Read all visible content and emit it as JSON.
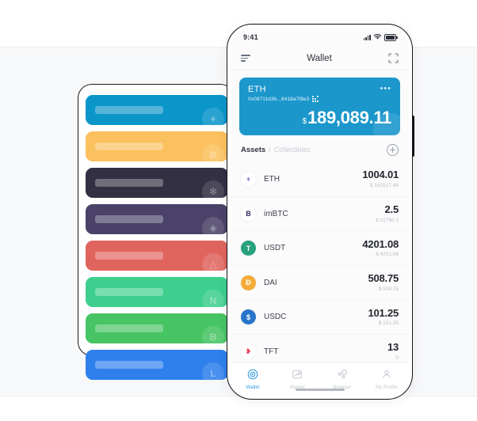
{
  "theme": {
    "accent": "#1c97cc",
    "tab_active": "#2f9ae0",
    "text_dark": "#23262e",
    "text_muted": "#b9bdc6"
  },
  "left_panel": {
    "name": "token-card-stack-placeholder",
    "cards": [
      {
        "color": "#0b96c9",
        "mark": "♦"
      },
      {
        "color": "#fbc15e",
        "mark": "B"
      },
      {
        "color": "#323042",
        "mark": "✻"
      },
      {
        "color": "#4a4268",
        "mark": "◈"
      },
      {
        "color": "#e0645e",
        "mark": "△"
      },
      {
        "color": "#3ecf8e",
        "mark": "N"
      },
      {
        "color": "#47c463",
        "mark": "B"
      },
      {
        "color": "#2f80ed",
        "mark": "L"
      }
    ]
  },
  "phone": {
    "status_bar": {
      "time": "9:41",
      "signal_icon": "cellular-signal-icon",
      "wifi_icon": "wifi-icon",
      "battery_icon": "battery-icon"
    },
    "nav": {
      "menu_icon": "hamburger-menu-icon",
      "title": "Wallet",
      "scan_icon": "scan-qr-icon"
    },
    "balance_card": {
      "symbol": "ETH",
      "address": "0x08711d3b...8418a7f8e3",
      "qr_icon": "qr-code-icon",
      "more_icon": "•••",
      "currency_symbol": "$",
      "amount": "189,089.11",
      "bg_color": "#1c97cc"
    },
    "assets_header": {
      "assets_label": "Assets",
      "separator": "/",
      "collectibles_label": "Collectibles",
      "add_icon": "plus-circle-icon"
    },
    "assets": [
      {
        "symbol": "ETH",
        "amount": "1004.01",
        "fiat": "$ 162517.48",
        "icon_bg": "#ffffff",
        "icon_fg": "#8a8fd6",
        "glyph": "♦"
      },
      {
        "symbol": "imBTC",
        "amount": "2.5",
        "fiat": "$ 21760.1",
        "icon_bg": "#ffffff",
        "icon_fg": "#2b2f5e",
        "glyph": "B"
      },
      {
        "symbol": "USDT",
        "amount": "4201.08",
        "fiat": "$ 4201.08",
        "icon_bg": "#26a17b",
        "icon_fg": "#ffffff",
        "glyph": "T"
      },
      {
        "symbol": "DAI",
        "amount": "508.75",
        "fiat": "$ 508.75",
        "icon_bg": "#f5ac37",
        "icon_fg": "#ffffff",
        "glyph": "Đ"
      },
      {
        "symbol": "USDC",
        "amount": "101.25",
        "fiat": "$ 101.25",
        "icon_bg": "#2775ca",
        "icon_fg": "#ffffff",
        "glyph": "$"
      },
      {
        "symbol": "TFT",
        "amount": "13",
        "fiat": "0",
        "icon_bg": "#ffffff",
        "icon_fg": "#e8415a",
        "glyph": "❥"
      }
    ],
    "tabs": [
      {
        "label": "Wallet",
        "icon": "wallet-target-icon",
        "active": true
      },
      {
        "label": "Market",
        "icon": "market-chart-icon",
        "active": false
      },
      {
        "label": "Browser",
        "icon": "browser-nodes-icon",
        "active": false
      },
      {
        "label": "My Profile",
        "icon": "user-profile-icon",
        "active": false
      }
    ]
  }
}
